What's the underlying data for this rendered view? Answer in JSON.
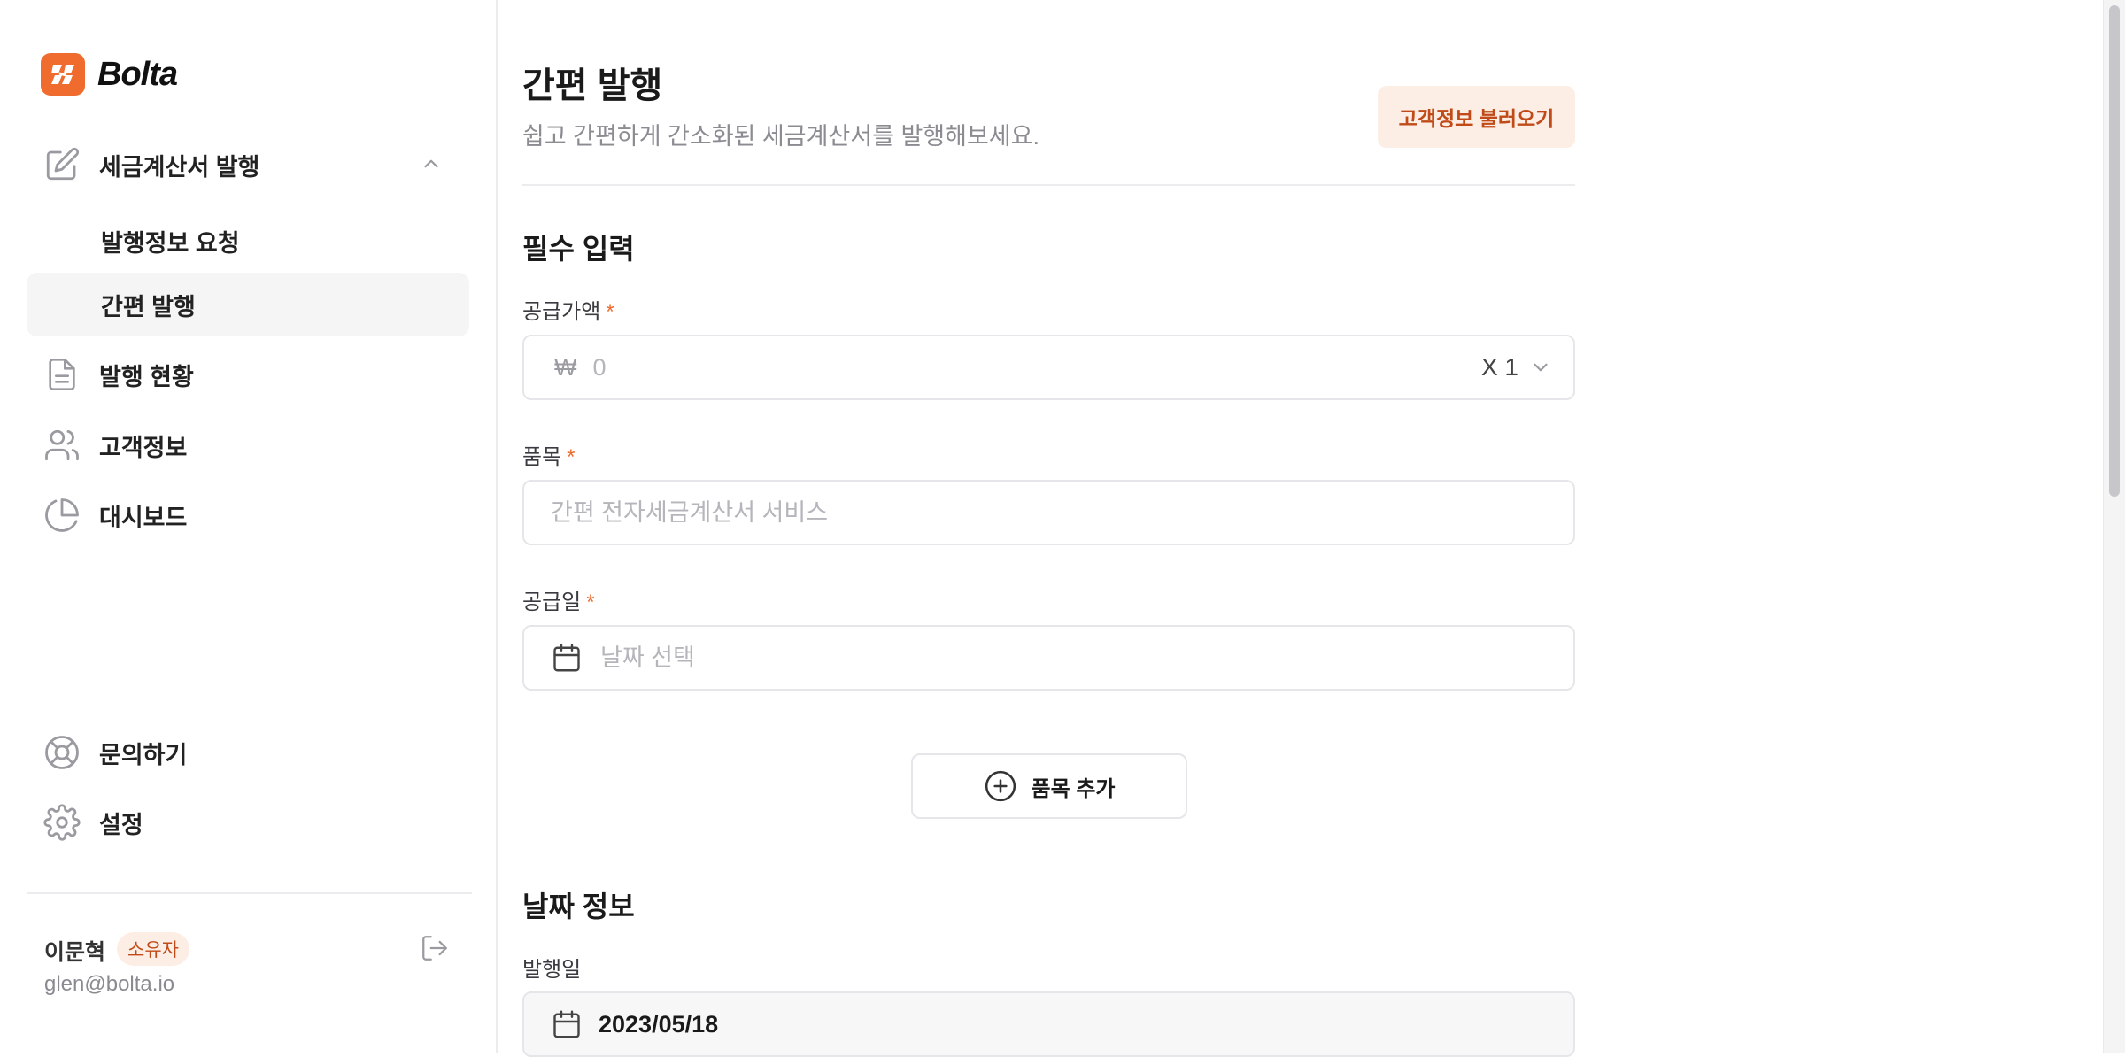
{
  "brand": {
    "name": "Bolta",
    "accent": "#ef6b2e"
  },
  "sidebar": {
    "items": [
      {
        "label": "세금계산서 발행",
        "icon": "edit-icon",
        "expanded": true,
        "children": [
          {
            "label": "발행정보 요청"
          },
          {
            "label": "간편 발행",
            "active": true
          }
        ]
      },
      {
        "label": "발행 현황",
        "icon": "document-icon"
      },
      {
        "label": "고객정보",
        "icon": "users-icon"
      },
      {
        "label": "대시보드",
        "icon": "pie-chart-icon"
      }
    ],
    "bottom_items": [
      {
        "label": "문의하기",
        "icon": "lifebuoy-icon"
      },
      {
        "label": "설정",
        "icon": "gear-icon"
      }
    ],
    "user": {
      "name": "이문혁",
      "role_badge": "소유자",
      "email": "glen@bolta.io"
    }
  },
  "main": {
    "title": "간편 발행",
    "subtitle": "쉽고 간편하게 간소화된 세금계산서를 발행해보세요.",
    "load_customer_button": "고객정보 불러오기",
    "required_section": {
      "title": "필수 입력",
      "supply_amount": {
        "label": "공급가액",
        "required_mark": "*",
        "currency": "₩",
        "placeholder": "0",
        "multiplier": "X 1"
      },
      "item": {
        "label": "품목",
        "required_mark": "*",
        "placeholder": "간편 전자세금계산서 서비스"
      },
      "supply_date": {
        "label": "공급일",
        "required_mark": "*",
        "placeholder": "날짜 선택"
      },
      "add_item_button": "품목 추가"
    },
    "date_section": {
      "title": "날짜 정보",
      "issue_date": {
        "label": "발행일",
        "value": "2023/05/18"
      }
    }
  }
}
